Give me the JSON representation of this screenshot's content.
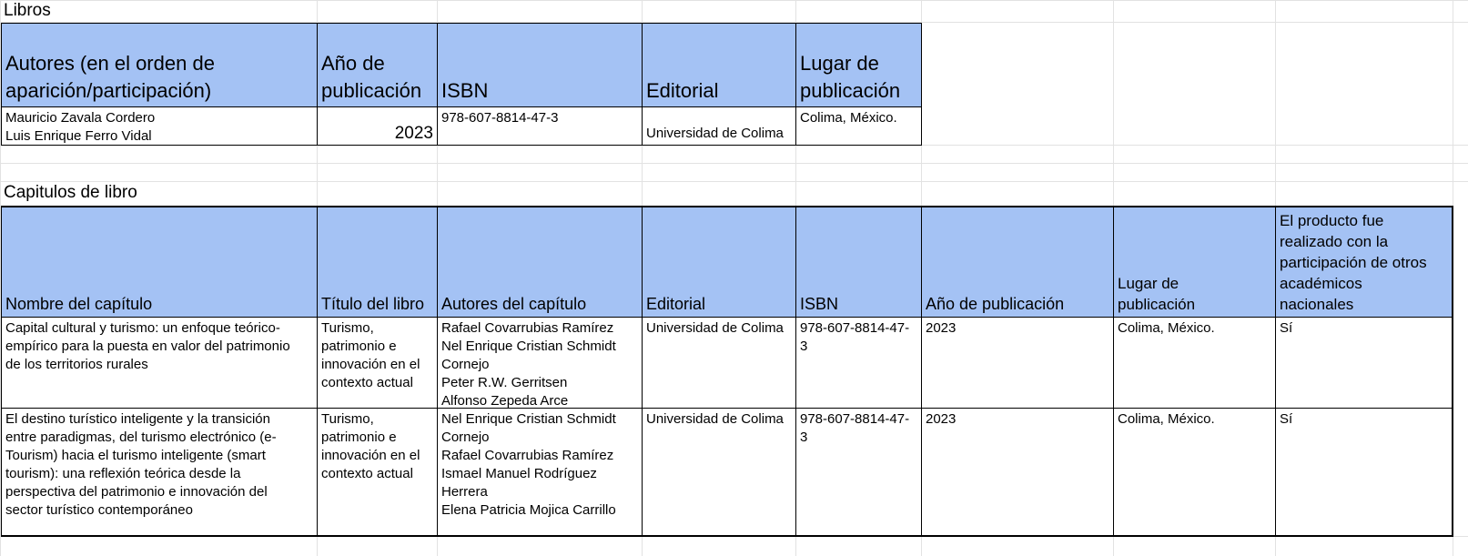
{
  "libros": {
    "title": "Libros",
    "headers": {
      "autores": "Autores (en el orden de\naparición/participación)",
      "anio": "Año de\npublicación",
      "isbn": "ISBN",
      "editorial": "Editorial",
      "lugar": "Lugar de\npublicación"
    },
    "row": {
      "autores": "Mauricio Zavala Cordero\nLuis Enrique Ferro Vidal",
      "anio": "2023",
      "isbn": "978-607-8814-47-3",
      "editorial": "Universidad de Colima",
      "lugar": "Colima, México."
    }
  },
  "capitulos": {
    "title": "Capitulos de libro",
    "headers": {
      "nombre": "Nombre del capítulo",
      "titulo": "Título del libro",
      "autores": "Autores del capítulo",
      "editorial": "Editorial",
      "isbn": "ISBN",
      "anio": "Año de publicación",
      "lugar": "Lugar de\npublicación",
      "participacion": "El producto fue\nrealizado con la\nparticipación de otros\nacadémicos\nnacionales"
    },
    "rows": [
      {
        "nombre": "Capital cultural y turismo: un enfoque teórico-\nempírico para la puesta en valor del patrimonio\nde los territorios rurales",
        "titulo": "Turismo,\npatrimonio e\ninnovación en el\ncontexto actual",
        "autores": "Rafael Covarrubias Ramírez\nNel Enrique Cristian Schmidt\nCornejo\nPeter R.W. Gerritsen\nAlfonso Zepeda Arce",
        "editorial": "Universidad de Colima",
        "isbn": "978-607-8814-47-\n3",
        "anio": "2023",
        "lugar": "Colima, México.",
        "participacion": "Sí"
      },
      {
        "nombre": "El destino turístico inteligente y la transición\nentre paradigmas, del turismo electrónico (e-\nTourism) hacia el turismo inteligente (smart\ntourism): una reflexión teórica desde la\nperspectiva del patrimonio e innovación del\nsector turístico contemporáneo",
        "titulo": "Turismo,\npatrimonio e\ninnovación en el\ncontexto actual",
        "autores": "Nel Enrique Cristian Schmidt\nCornejo\nRafael Covarrubias Ramírez\nIsmael Manuel Rodríguez\nHerrera\nElena Patricia Mojica Carrillo",
        "editorial": "Universidad de Colima",
        "isbn": "978-607-8814-47-\n3",
        "anio": "2023",
        "lugar": "Colima, México.",
        "participacion": "Sí"
      }
    ]
  },
  "colors": {
    "header_fill": "#a4c2f4",
    "gridline": "#e2e2e2",
    "border": "#000000"
  }
}
